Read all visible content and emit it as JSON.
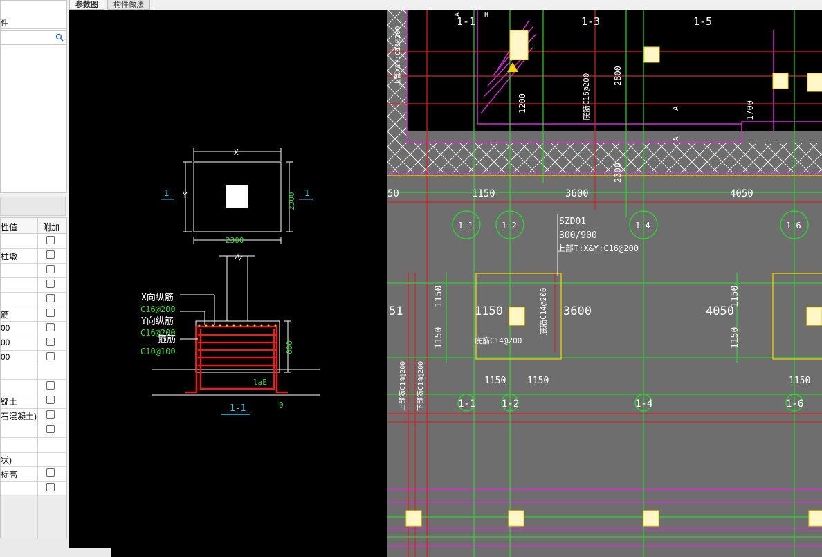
{
  "tabs": [
    {
      "label": "参数图",
      "active": true
    },
    {
      "label": "构件做法",
      "active": false
    }
  ],
  "left_panel": {
    "top_label": "件",
    "search_icon": "search-icon",
    "table": {
      "headers": {
        "value": "性值",
        "attach": "附加"
      },
      "rows": [
        {
          "value": "",
          "has_checkbox": true
        },
        {
          "value": "柱墩",
          "has_checkbox": true
        },
        {
          "value": "",
          "has_checkbox": true
        },
        {
          "value": "",
          "has_checkbox": true
        },
        {
          "value": "",
          "has_checkbox": true
        },
        {
          "value": "筋",
          "has_checkbox": true
        },
        {
          "value": "00",
          "has_checkbox": true
        },
        {
          "value": "00",
          "has_checkbox": true
        },
        {
          "value": "00",
          "has_checkbox": true
        },
        {
          "value": "",
          "has_checkbox": false
        },
        {
          "value": "",
          "has_checkbox": true
        },
        {
          "value": "疑土",
          "has_checkbox": true
        },
        {
          "value": "石混凝土)",
          "has_checkbox": true
        },
        {
          "value": "",
          "has_checkbox": true
        },
        {
          "value": "",
          "has_checkbox": false
        },
        {
          "value": "状)",
          "has_checkbox": false
        },
        {
          "value": "标高",
          "has_checkbox": true
        },
        {
          "value": "",
          "has_checkbox": true
        },
        {
          "value": "",
          "has_checkbox": false
        },
        {
          "value": "",
          "has_checkbox": false
        },
        {
          "value": "",
          "has_checkbox": false
        }
      ]
    }
  },
  "param_drawing": {
    "plan": {
      "dim_x": "X",
      "dim_y": "Y",
      "dim_bottom": "2300",
      "dim_right": "2300",
      "section_left": "1",
      "section_right": "1"
    },
    "section": {
      "x_bar_label": "X向纵筋",
      "x_bar_value": "C16@200",
      "y_bar_label": "Y向纵筋",
      "y_bar_value": "C16@200",
      "stirrup_label": "箍筋",
      "stirrup_value": "C10@100",
      "height": "600",
      "anchor": "laE",
      "cover": "0",
      "title": "1-1"
    }
  },
  "cad_plan": {
    "axes_top": [
      "1-1",
      "1-3",
      "1-5"
    ],
    "axes_row": [
      "1-1",
      "1-2",
      "1-4",
      "1-6"
    ],
    "axes_bottom": [
      "1-1",
      "1-2",
      "1-4",
      "1-6"
    ],
    "top_dims": [
      "50",
      "1150",
      "3600",
      "4050"
    ],
    "mid_dims": [
      "51",
      "1150",
      "3600",
      "4050"
    ],
    "col_label": {
      "name": "SZD01",
      "size": "300/900",
      "rebar": "上部T:X&Y:C16@200"
    },
    "vertical_dims": [
      "2800",
      "1200",
      "1700",
      "2300"
    ],
    "vertical_rebar": [
      "底筋C16@200",
      "底筋C14@200",
      "上部筋C14@200",
      "下部筋C14@200"
    ],
    "rebar_h": "底筋C14@200",
    "pad_dims": [
      "1150",
      "1150",
      "1150",
      "1150",
      "1150",
      "1150",
      "1150"
    ],
    "section_marks": [
      "A",
      "A"
    ],
    "top_marks": [
      "A",
      "H"
    ],
    "top_vert_text": "上部X&Y:C16@200"
  }
}
